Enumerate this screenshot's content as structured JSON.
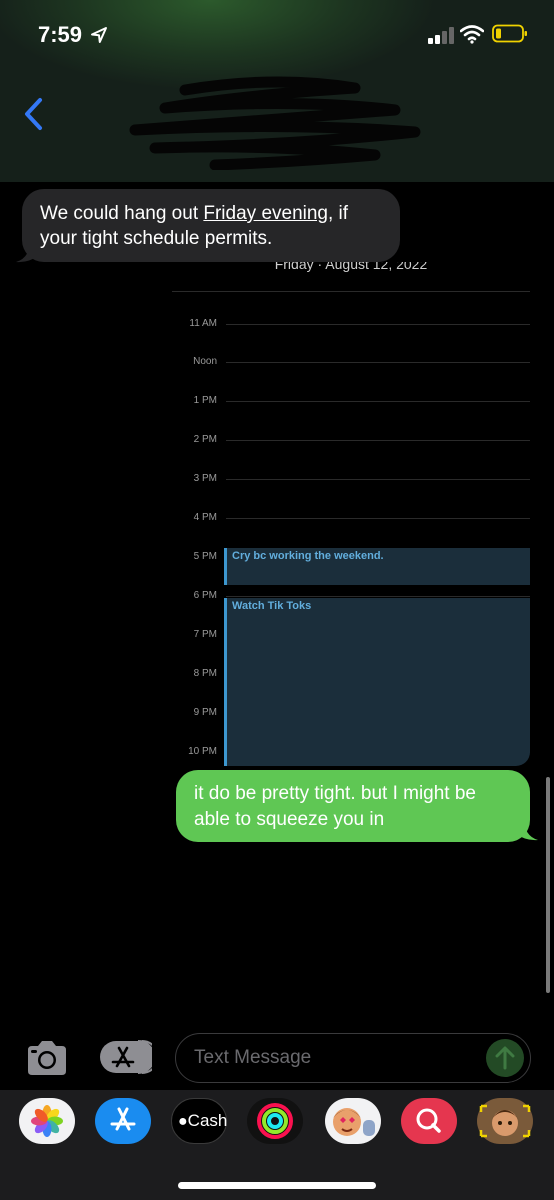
{
  "status_bar": {
    "time": "7:59",
    "icons": [
      "location-arrow-icon",
      "cellular-signal-icon",
      "wifi-icon",
      "battery-icon"
    ],
    "battery_color": "#f0d200"
  },
  "header": {
    "back_icon": "chevron-left-icon",
    "accent_color": "#3478f6"
  },
  "messages": [
    {
      "direction": "incoming",
      "line1_before": "We could hang out ",
      "line1_link": "Friday evening",
      "line1_after": ",  if",
      "line2": "your tight schedule permits."
    },
    {
      "direction": "outgoing",
      "line1": "it do be pretty tight. but I might be",
      "line2": "able to squeeze you in",
      "color": "#5fc754"
    }
  ],
  "calendar_preview": {
    "date": "Friday · August 12, 2022",
    "hours": [
      "11 AM",
      "Noon",
      "1 PM",
      "2 PM",
      "3 PM",
      "4 PM",
      "5 PM",
      "6 PM",
      "7 PM",
      "8 PM",
      "9 PM",
      "10 PM"
    ],
    "events": [
      {
        "title": "Cry bc working the weekend.",
        "start": "5 PM",
        "end": "6 PM"
      },
      {
        "title": "Watch Tik Toks",
        "start": "6 PM",
        "end": "11 PM"
      }
    ],
    "event_color": "#3d97cf"
  },
  "input_bar": {
    "placeholder": "Text Message",
    "camera_icon": "camera-icon",
    "apps_icon": "app-store-icon",
    "send_icon": "send-arrow-icon"
  },
  "app_drawer": {
    "apps": [
      {
        "name": "photos-icon"
      },
      {
        "name": "app-store-icon"
      },
      {
        "name": "apple-cash-icon",
        "label": "Cash"
      },
      {
        "name": "activity-rings-icon"
      },
      {
        "name": "memoji-stickers-icon"
      },
      {
        "name": "images-search-icon"
      },
      {
        "name": "memoji-icon"
      }
    ]
  }
}
